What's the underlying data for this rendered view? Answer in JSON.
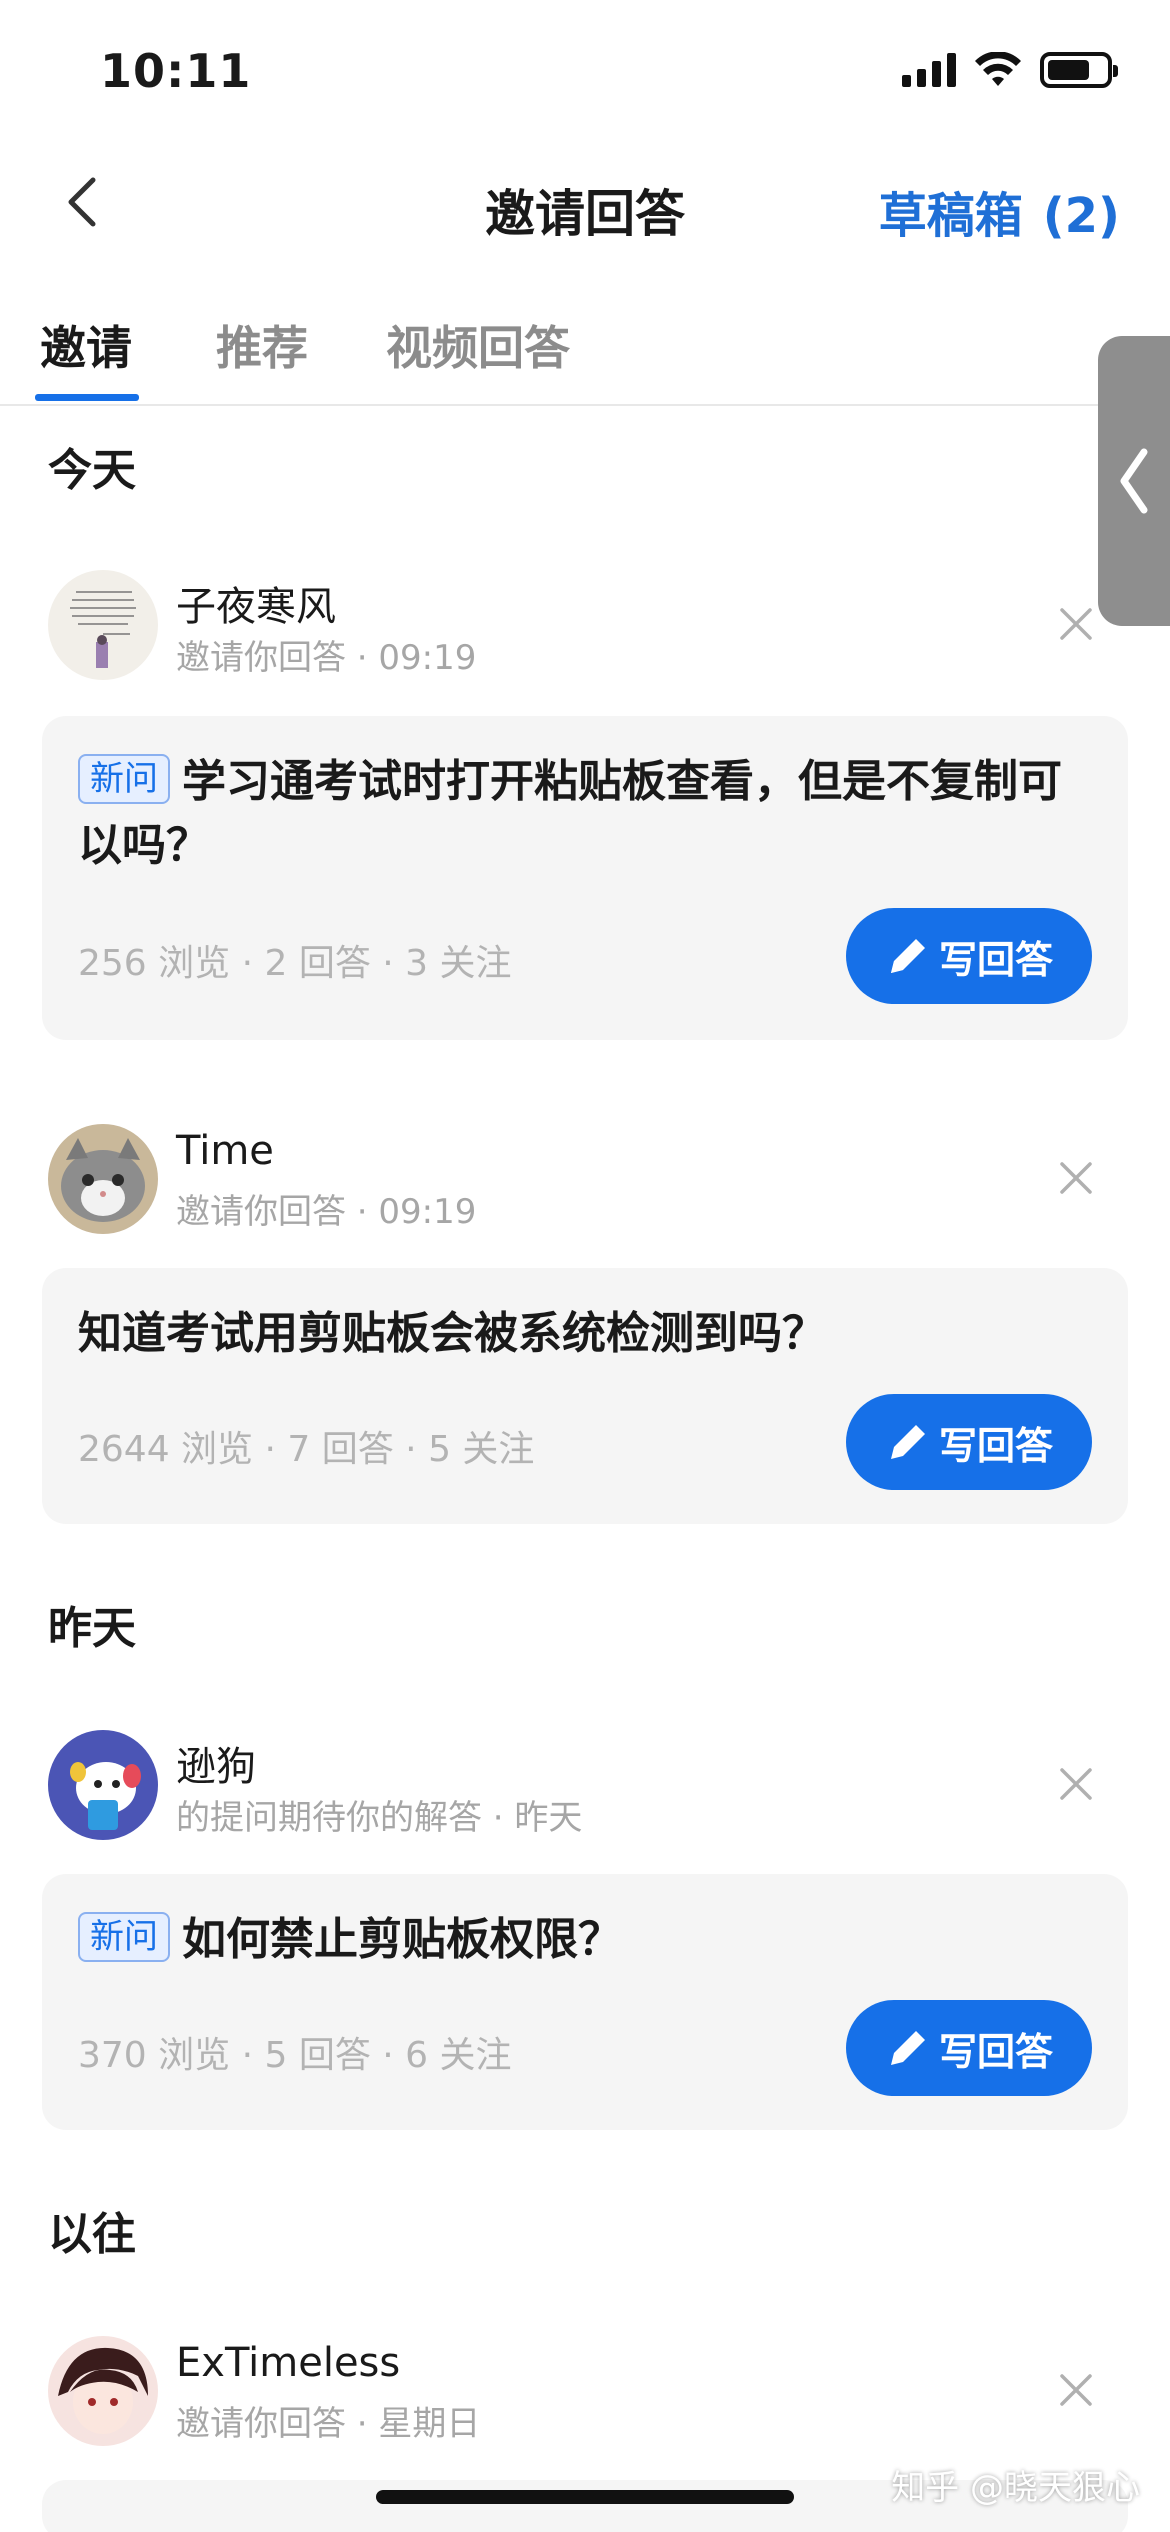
{
  "status_bar": {
    "time": "10:11"
  },
  "nav": {
    "title": "邀请回答",
    "drafts_label": "草稿箱",
    "drafts_count": "(2)"
  },
  "tabs": [
    {
      "label": "邀请",
      "active": true
    },
    {
      "label": "推荐",
      "active": false
    },
    {
      "label": "视频回答",
      "active": false
    }
  ],
  "sections": {
    "today": "今天",
    "yesterday": "昨天",
    "earlier": "以往"
  },
  "items": [
    {
      "user": "子夜寒风",
      "meta": "邀请你回答 · 09:19",
      "badge": "新问",
      "question": "学习通考试时打开粘贴板查看，但是不复制可以吗？",
      "stats": "256 浏览 · 2 回答 · 3 关注",
      "action": "写回答"
    },
    {
      "user": "Time",
      "meta": "邀请你回答 · 09:19",
      "question": "知道考试用剪贴板会被系统检测到吗？",
      "stats": "2644 浏览 · 7 回答 · 5 关注",
      "action": "写回答"
    },
    {
      "user": "逊狗",
      "meta": "的提问期待你的解答 · 昨天",
      "badge": "新问",
      "question": "如何禁止剪贴板权限？",
      "stats": "370 浏览 · 5 回答 · 6 关注",
      "action": "写回答"
    },
    {
      "user": "ExTimeless",
      "meta": "邀请你回答 · 星期日"
    }
  ],
  "watermark": "知乎 @晓天狠心",
  "colors": {
    "accent": "#1670e8",
    "card_bg": "#f5f5f5",
    "muted": "#a6a6a6"
  }
}
